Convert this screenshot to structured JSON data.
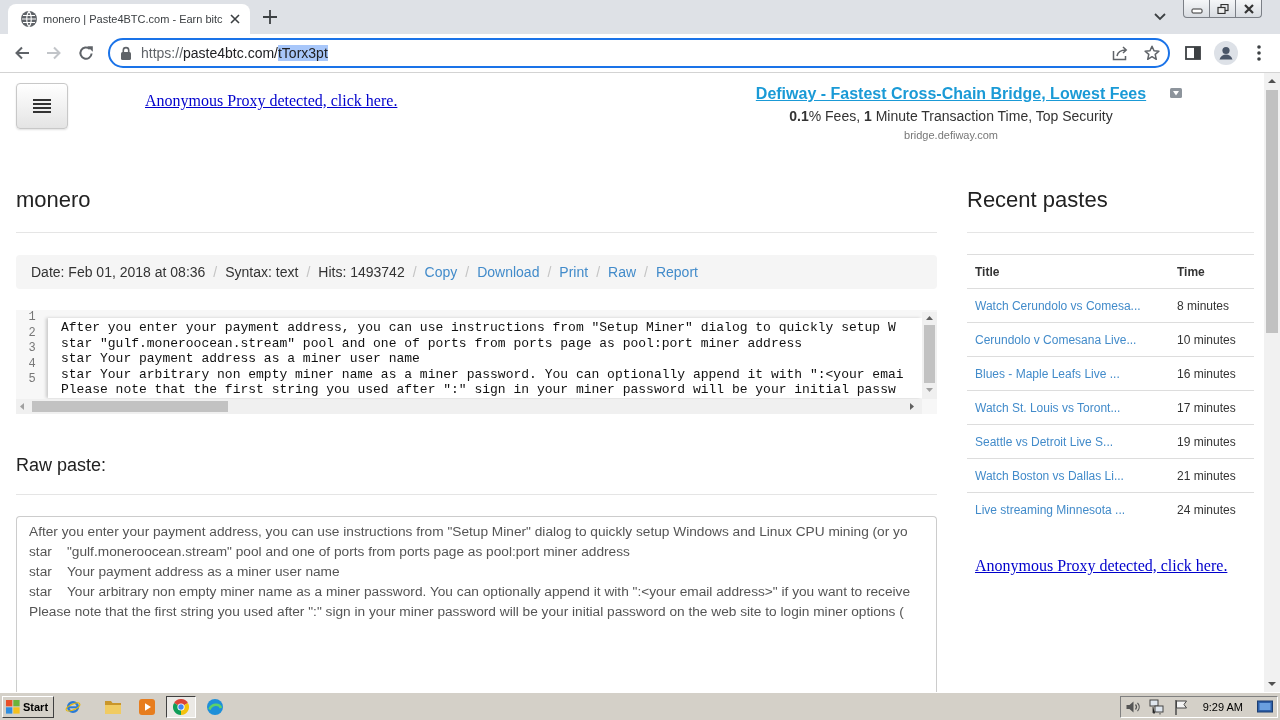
{
  "browser": {
    "tabs": [
      {
        "title": "monero | Paste4BTC.com - Earn bitc",
        "selected": true
      }
    ],
    "nav_buttons": [
      {
        "kind": "back",
        "disabled": false
      },
      {
        "kind": "forward",
        "disabled": true
      },
      {
        "kind": "reload",
        "disabled": false
      }
    ],
    "address_bar": {
      "url_parts": [
        {
          "text": "https://",
          "kind": "scheme",
          "selected": false
        },
        {
          "text": "paste4btc.com/",
          "kind": "host",
          "selected": false
        },
        {
          "text": "tTorx3pt",
          "kind": "path",
          "selected": true
        }
      ]
    }
  },
  "header": {
    "proxy_notice": "Anonymous Proxy detected, click here.",
    "ad": {
      "headline": "Defiway - Fastest Cross-Chain Bridge, Lowest Fees",
      "body": "**0.1**% Fees, **1** Minute Transaction Time, Top Security",
      "domain": "bridge.defiway.com"
    }
  },
  "paste": {
    "title": "monero",
    "meta": [
      {
        "text": "Date: Feb 01, 2018 at 08:36",
        "kind": "info"
      },
      {
        "separator": "/",
        "text": "Syntax: text",
        "kind": "info"
      },
      {
        "separator": "/",
        "text": "Hits: 1493742",
        "kind": "info"
      },
      {
        "separator": "/",
        "text": "Copy",
        "kind": "link"
      },
      {
        "separator": "/",
        "text": "Download",
        "kind": "link"
      },
      {
        "separator": "/",
        "text": "Print",
        "kind": "link"
      },
      {
        "separator": "/",
        "text": "Raw",
        "kind": "link"
      },
      {
        "separator": "/",
        "text": "Report",
        "kind": "link"
      }
    ],
    "code_lines": [
      {
        "number": "1",
        "text": "After you enter your payment address, you can use instructions from \"Setup Miner\" dialog to quickly setup W"
      },
      {
        "number": "2",
        "text": "star \"gulf.moneroocean.stream\" pool and one of ports from ports page as pool:port miner address"
      },
      {
        "number": "3",
        "text": "star Your payment address as a miner user name"
      },
      {
        "number": "4",
        "text": "star Your arbitrary non empty miner name as a miner password. You can optionally append it with \":<your emai"
      },
      {
        "number": "5",
        "text": "Please note that the first string you used after \":\" sign in your miner password will be your initial passw"
      }
    ],
    "raw_heading": "Raw paste:",
    "raw_lines": [
      "After you enter your payment address, you can use instructions from \"Setup Miner\" dialog to quickly setup Windows and Linux CPU mining (or yo",
      "star\t\"gulf.moneroocean.stream\" pool and one of ports from ports page as pool:port miner address",
      "star\tYour payment address as a miner user name",
      "star\tYour arbitrary non empty miner name as a miner password. You can optionally append it with \":<your email address>\" if you want to receive",
      "Please note that the first string you used after \":\" sign in your miner password will be your initial password on the web site to login miner options ("
    ]
  },
  "sidebar": {
    "heading": "Recent pastes",
    "columns": [
      "Title",
      "Time"
    ],
    "rows": [
      {
        "title": "Watch Cerundolo vs Comesa...",
        "time": "8 minutes"
      },
      {
        "title": "Cerundolo v Comesana Live...",
        "time": "10 minutes"
      },
      {
        "title": "Blues - Maple Leafs Live ...",
        "time": "16 minutes"
      },
      {
        "title": "Watch St. Louis vs Toront...",
        "time": "17 minutes"
      },
      {
        "title": "Seattle vs Detroit Live S...",
        "time": "19 minutes"
      },
      {
        "title": "Watch Boston vs Dallas Li...",
        "time": "21 minutes"
      },
      {
        "title": "Live streaming Minnesota ...",
        "time": "24 minutes"
      }
    ],
    "proxy_notice": "Anonymous Proxy detected, click here."
  },
  "taskbar": {
    "start_label": "Start",
    "apps": [
      {
        "kind": "e_logo",
        "selected": false
      },
      {
        "kind": "folder",
        "selected": false
      },
      {
        "kind": "player",
        "selected": false
      },
      {
        "kind": "circle_logo",
        "selected": true
      },
      {
        "kind": "swirl_logo",
        "selected": false
      }
    ],
    "clock": "9:29 AM"
  }
}
